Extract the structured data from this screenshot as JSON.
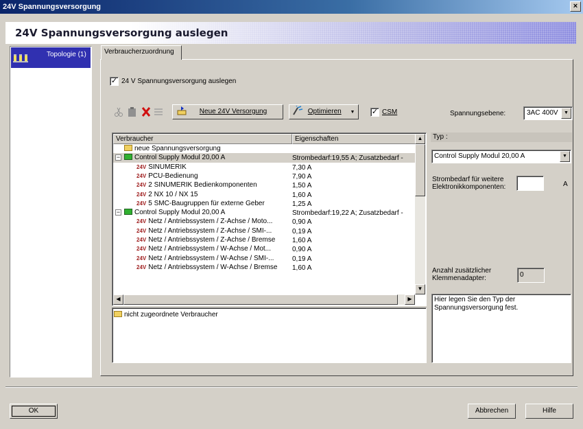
{
  "window": {
    "title": "24V Spannungsversorgung",
    "close_glyph": "×"
  },
  "header": {
    "title": "24V Spannungsversorgung auslegen"
  },
  "sidebar": {
    "items": [
      {
        "label": "Topologie (1)",
        "icon": "topology-icon"
      }
    ]
  },
  "tabs": [
    {
      "label": "Verbraucherzuordnung"
    }
  ],
  "design_checkbox": {
    "label": "24 V Spannungsversorgung auslegen",
    "checked": true
  },
  "toolbar": {
    "new_supply_label": "Neue 24V Versorgung",
    "optimize_label": "Optimieren",
    "csm_label": "CSM",
    "csm_checked": true,
    "voltage_level_label": "Spannungsebene:",
    "voltage_level_value": "3AC 400V"
  },
  "tree": {
    "columns": [
      "Verbraucher",
      "Eigenschaften"
    ],
    "rows": [
      {
        "indent": 1,
        "kind": "new",
        "label": "neue Spannungsversorgung",
        "prop": ""
      },
      {
        "indent": 0,
        "kind": "group",
        "label": "Control Supply Modul 20,00 A",
        "prop": "Strombedarf:19,55 A; Zusatzbedarf -",
        "selected": true
      },
      {
        "indent": 2,
        "kind": "leaf",
        "label": "SINUMERIK",
        "prop": "7,30 A"
      },
      {
        "indent": 2,
        "kind": "leaf",
        "label": "PCU-Bedienung",
        "prop": "7,90 A"
      },
      {
        "indent": 2,
        "kind": "leaf",
        "label": "2 SINUMERIK Bedienkomponenten",
        "prop": "1,50 A"
      },
      {
        "indent": 2,
        "kind": "leaf",
        "label": "2 NX 10 / NX 15",
        "prop": "1,60 A"
      },
      {
        "indent": 2,
        "kind": "leaf",
        "label": "5 SMC-Baugruppen für externe Geber",
        "prop": "1,25 A"
      },
      {
        "indent": 0,
        "kind": "group",
        "label": "Control Supply Modul 20,00 A",
        "prop": "Strombedarf:19,22 A; Zusatzbedarf -"
      },
      {
        "indent": 2,
        "kind": "leaf",
        "label": "Netz / Antriebssystem / Z-Achse / Moto...",
        "prop": "0,90 A"
      },
      {
        "indent": 2,
        "kind": "leaf",
        "label": "Netz / Antriebssystem / Z-Achse / SMI-...",
        "prop": "0,19 A"
      },
      {
        "indent": 2,
        "kind": "leaf",
        "label": "Netz / Antriebssystem / Z-Achse / Bremse",
        "prop": "1,60 A"
      },
      {
        "indent": 2,
        "kind": "leaf",
        "label": "Netz / Antriebssystem / W-Achse / Mot...",
        "prop": "0,90 A"
      },
      {
        "indent": 2,
        "kind": "leaf",
        "label": "Netz / Antriebssystem / W-Achse / SMI-...",
        "prop": "0,19 A"
      },
      {
        "indent": 2,
        "kind": "leaf",
        "label": "Netz / Antriebssystem / W-Achse / Bremse",
        "prop": "1,60 A"
      }
    ],
    "v24_tag": "24V"
  },
  "unassigned": {
    "label": "nicht zugeordnete Verbraucher"
  },
  "right": {
    "type_label": "Typ :",
    "type_value": "Control Supply Modul 20,00 A",
    "extra_current_label_1": "Strombedarf für weitere",
    "extra_current_label_2": "Elektronikkomponenten:",
    "extra_current_value": "",
    "extra_current_unit": "A",
    "adapter_label_1": "Anzahl zusätzlicher",
    "adapter_label_2": "Klemmenadapter:",
    "adapter_value": "0",
    "help_text": "Hier legen Sie den Typ der Spannungsversorgung fest."
  },
  "footer": {
    "ok_label": "OK",
    "cancel_label": "Abbrechen",
    "help_label": "Hilfe"
  }
}
